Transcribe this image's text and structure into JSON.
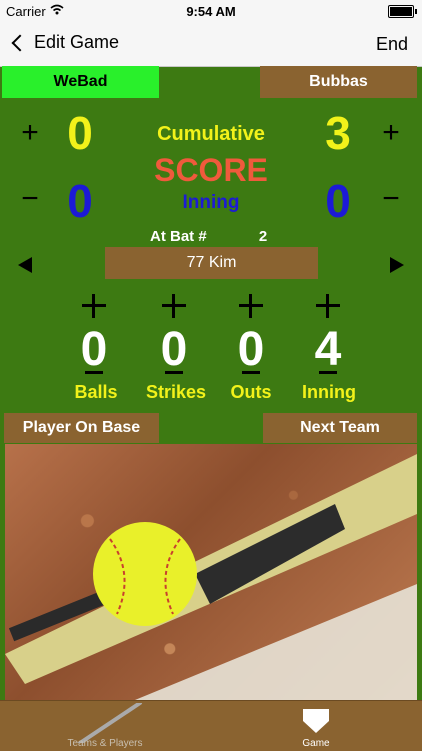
{
  "status": {
    "carrier": "Carrier",
    "time": "9:54 AM"
  },
  "nav": {
    "back_label": "Edit Game",
    "end_label": "End"
  },
  "teams": {
    "left": "WeBad",
    "right": "Bubbas"
  },
  "score": {
    "left_cumulative": "0",
    "right_cumulative": "3",
    "left_inning": "0",
    "right_inning": "0",
    "cumulative_label": "Cumulative",
    "score_label": "SCORE",
    "inning_label": "Inning"
  },
  "at_bat": {
    "label": "At Bat #",
    "number": "2",
    "player": "77 Kim"
  },
  "counters": [
    {
      "label": "Balls",
      "value": "0"
    },
    {
      "label": "Strikes",
      "value": "0"
    },
    {
      "label": "Outs",
      "value": "0"
    },
    {
      "label": "Inning",
      "value": "4"
    }
  ],
  "buttons": {
    "player_on_base": "Player On Base",
    "next_team": "Next Team"
  },
  "tabs": [
    {
      "label": "Teams & Players",
      "icon": "bat-icon"
    },
    {
      "label": "Game",
      "icon": "home-plate-icon"
    }
  ],
  "colors": {
    "field": "#3d7a12",
    "brown": "#8a6330",
    "green_team": "#29f02b",
    "yellow": "#f2f21a",
    "blue": "#1c1ad6",
    "red": "#f05a3c"
  }
}
